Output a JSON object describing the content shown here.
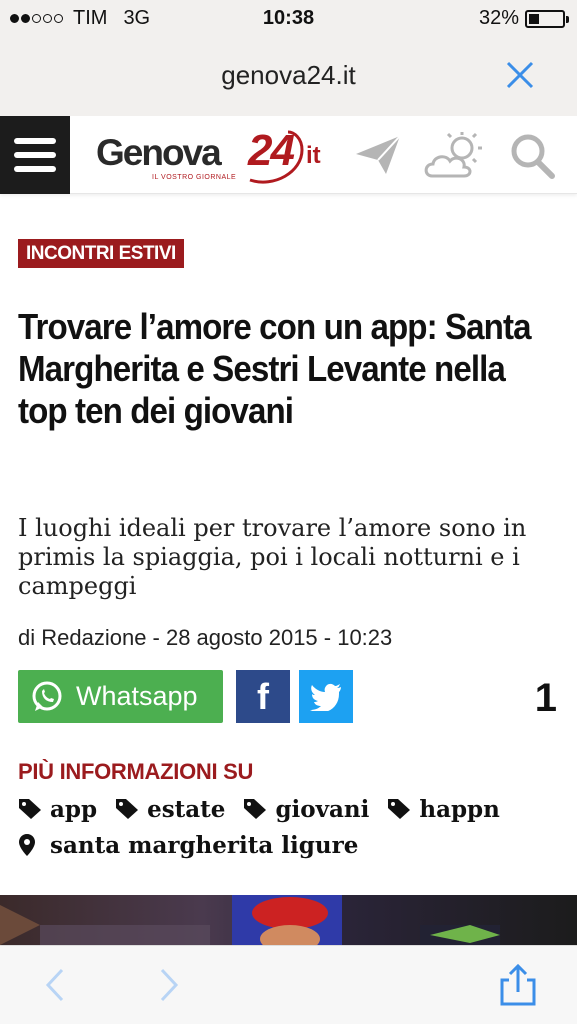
{
  "status_bar": {
    "carrier": "TIM",
    "network": "3G",
    "time": "10:38",
    "battery": "32%",
    "battery_level": 0.32,
    "signal_bars_filled": 2,
    "signal_bars_total": 5
  },
  "url_bar": {
    "url": "genova24.it"
  },
  "site_header": {
    "logo_name": "Genova",
    "logo_number": "24",
    "logo_tld": "it",
    "logo_tagline": "IL VOSTRO GIORNALE",
    "icons": [
      "menu-icon",
      "send-icon",
      "weather-icon",
      "search-icon"
    ]
  },
  "article": {
    "category": "INCONTRI ESTIVI",
    "headline": "Trovare l’amore con un app: Santa Margherita e Sestri Levante nella top ten dei giovani",
    "subtitle": "I luoghi ideali per trovare l’amore sono in primis la spiaggia, poi i locali notturni e i campeggi",
    "byline": "di Redazione - 28 agosto 2015 - 10:23"
  },
  "share": {
    "whatsapp_label": "Whatsapp",
    "facebook_glyph": "f",
    "comment_count": "1"
  },
  "more_info": {
    "title": "PIÙ INFORMAZIONI SU",
    "tags": [
      "app",
      "estate",
      "giovani",
      "happn"
    ],
    "place": "santa margherita ligure"
  },
  "colors": {
    "brand_red": "#9b1b1e",
    "whatsapp_green": "#4caf50",
    "facebook_blue": "#2d4a8a",
    "twitter_blue": "#1da1f2",
    "safari_blue": "#3b8ee8"
  }
}
